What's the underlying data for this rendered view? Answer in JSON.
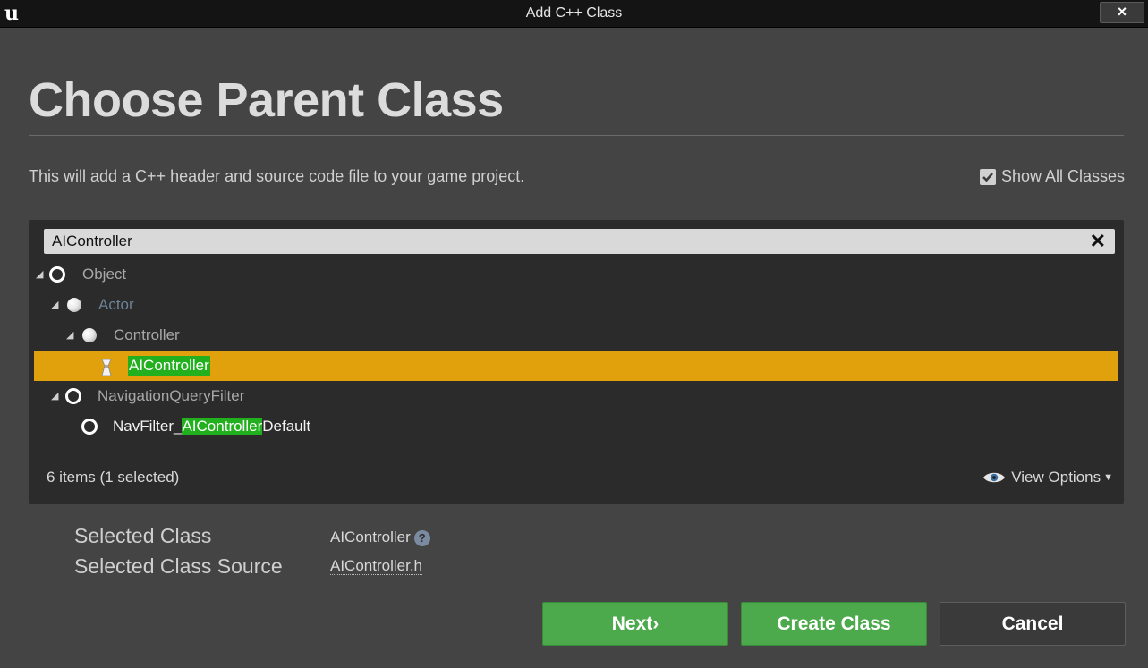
{
  "window": {
    "title": "Add C++ Class",
    "close_label": "×",
    "logo_label": "u"
  },
  "header": {
    "title": "Choose Parent Class",
    "description": "This will add a C++ header and source code file to your game project.",
    "show_all_classes": {
      "label": "Show All Classes",
      "checked": true
    }
  },
  "search": {
    "value": "AIController",
    "clear_label": "✕"
  },
  "tree": [
    {
      "label": "Object",
      "icon": "class-ring-icon",
      "expanded": true
    },
    {
      "label": "Actor",
      "icon": "actor-sphere-icon",
      "expanded": true
    },
    {
      "label": "Controller",
      "icon": "actor-sphere-icon",
      "expanded": true
    },
    {
      "label": "AIController",
      "icon": "ai-controller-icon",
      "selected": true
    },
    {
      "label": "NavigationQueryFilter",
      "icon": "class-ring-icon",
      "expanded": true
    },
    {
      "label_pre": "NavFilter_",
      "label_match": "AIController",
      "label_post": "Default",
      "icon": "class-ring-icon"
    }
  ],
  "panel_footer": {
    "count": "6 items (1 selected)",
    "view_options": "View Options"
  },
  "selection": {
    "class_label": "Selected Class",
    "class_value": "AIController",
    "source_label": "Selected Class Source",
    "source_value": "AIController.h"
  },
  "buttons": {
    "next": "Next",
    "next_suffix": "›",
    "create": "Create Class",
    "cancel": "Cancel"
  },
  "colors": {
    "selection_row": "#e0a10c",
    "match_highlight": "#22b01e",
    "primary_button": "#4caa4c"
  }
}
